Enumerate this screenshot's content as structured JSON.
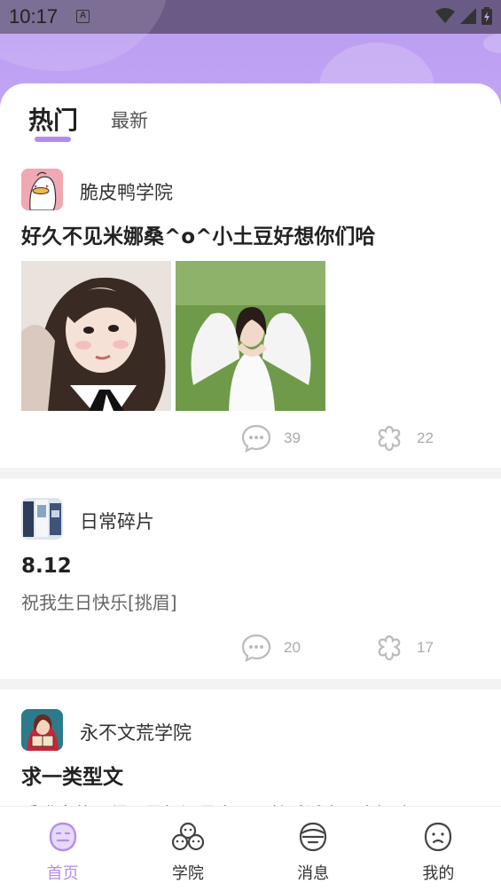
{
  "status": {
    "time": "10:17",
    "badge": "A"
  },
  "tabs": [
    {
      "label": "热门",
      "active": true
    },
    {
      "label": "最新",
      "active": false
    }
  ],
  "posts": [
    {
      "author": "脆皮鸭学院",
      "title": "好久不见米娜桑^o^小土豆好想你们哈",
      "body": "",
      "images": [
        "girl-portrait-photo",
        "angel-wings-photo"
      ],
      "comments": "39",
      "likes": "22"
    },
    {
      "author": "日常碎片",
      "title": "8.12",
      "body": "祝我生日快乐[挑眉]",
      "images": [],
      "comments": "20",
      "likes": "17"
    },
    {
      "author": "永不文荒学院",
      "title": "求一类型文",
      "body": "受嘴鼻的不得了是好还是直男！然后诱人不自知嘛o<"
    }
  ],
  "nav": [
    {
      "label": "首页",
      "icon": "home-face-icon",
      "active": true
    },
    {
      "label": "学院",
      "icon": "academy-icon",
      "active": false
    },
    {
      "label": "消息",
      "icon": "message-icon",
      "active": false
    },
    {
      "label": "我的",
      "icon": "profile-face-icon",
      "active": false
    }
  ],
  "colors": {
    "accent": "#b48cf0",
    "header": "#c3a6f4"
  }
}
